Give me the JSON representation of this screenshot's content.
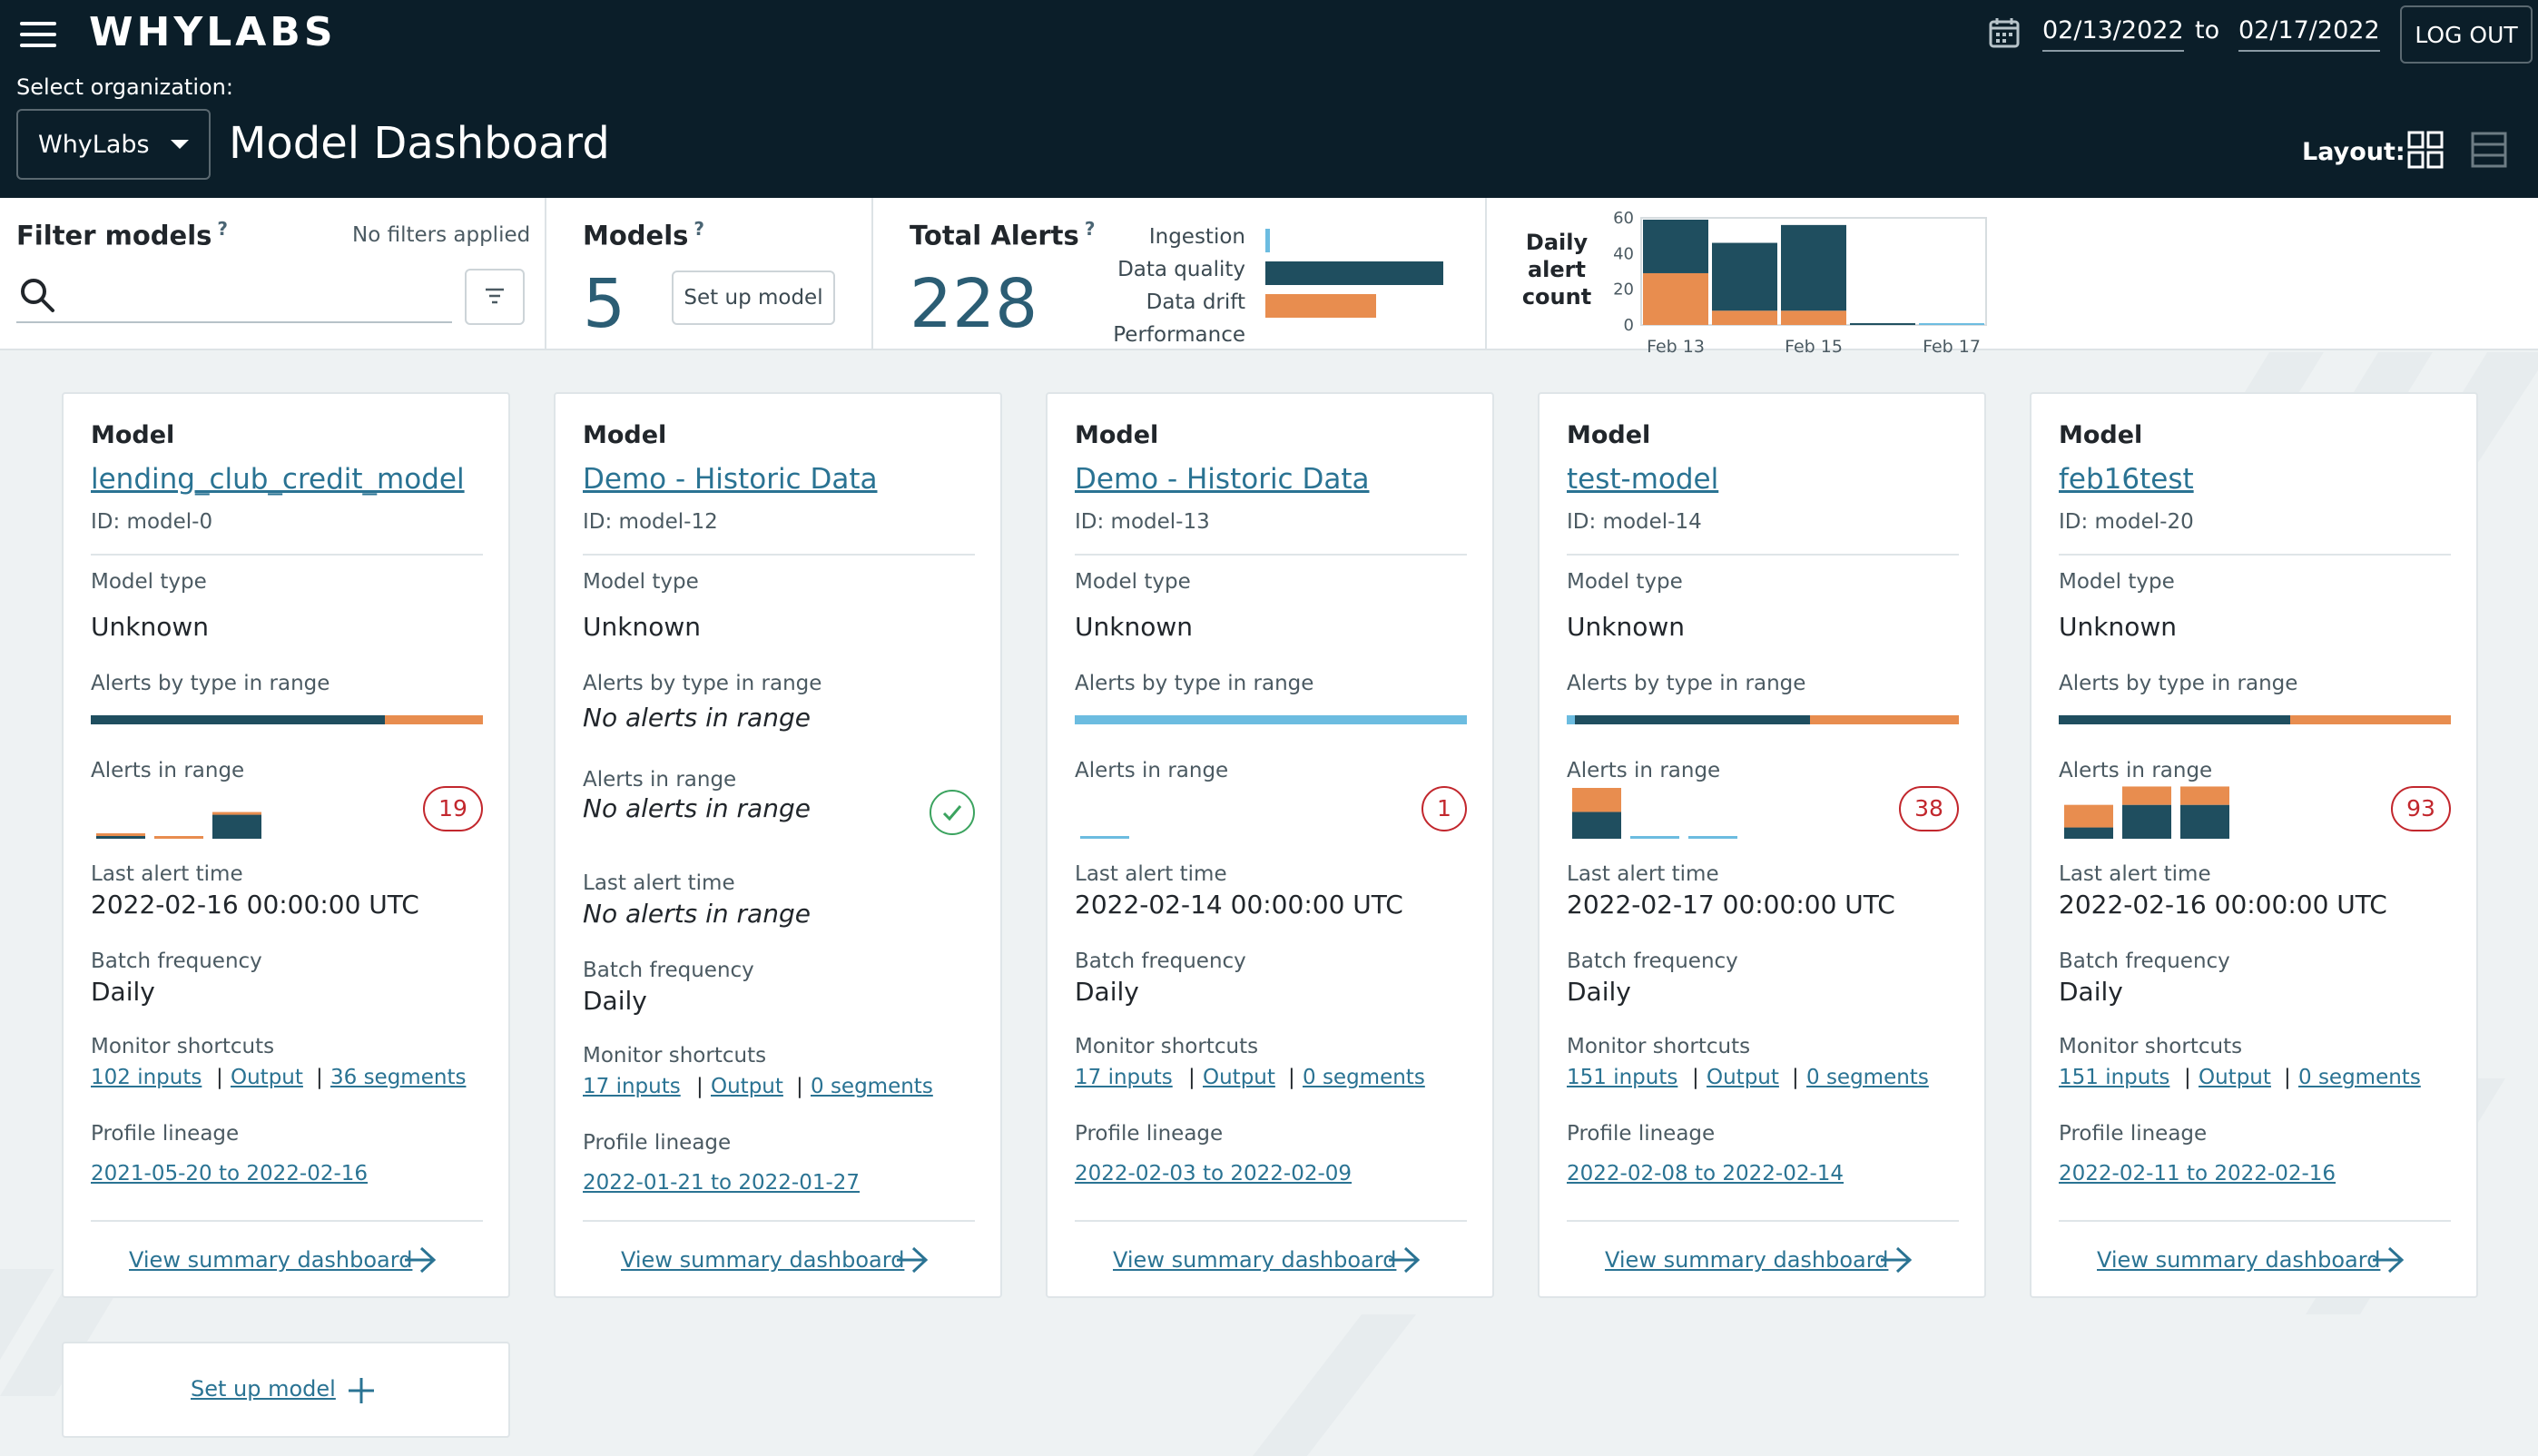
{
  "app": {
    "logo": "WHYLABS",
    "page_title": "Model Dashboard"
  },
  "header": {
    "org_label": "Select organization:",
    "org_selected": "WhyLabs",
    "date_from": "02/13/2022",
    "date_to_label": "to",
    "date_to": "02/17/2022",
    "logout": "LOG OUT",
    "layout_label": "Layout:"
  },
  "filter": {
    "title": "Filter models",
    "help": "?",
    "status": "No filters applied",
    "search_placeholder": "",
    "search_value": ""
  },
  "models_summary": {
    "title": "Models",
    "help": "?",
    "count": "5",
    "setup_button": "Set up model"
  },
  "alerts_summary": {
    "title": "Total Alerts",
    "help": "?",
    "count": "228",
    "types": [
      {
        "label": "Ingestion",
        "value": 1,
        "color": "#6cbce0"
      },
      {
        "label": "Data quality",
        "value": 98,
        "color": "#1f4e5f"
      },
      {
        "label": "Data drift",
        "value": 61,
        "color": "#e88d4f"
      },
      {
        "label": "Performance",
        "value": 0,
        "color": "#1f4e5f"
      }
    ],
    "max": 100
  },
  "daily_chart": {
    "label": "Daily alert count",
    "chart_data": {
      "type": "bar",
      "categories": [
        "Feb 13",
        "Feb 14",
        "Feb 15",
        "Feb 16",
        "Feb 17"
      ],
      "x_tick_labels": [
        "Feb 13",
        "Feb 15",
        "Feb 17"
      ],
      "series": [
        {
          "values": [
            29,
            8,
            8,
            0,
            0
          ],
          "color": "#e88d4f"
        },
        {
          "values": [
            30,
            38,
            48,
            1,
            0
          ],
          "color": "#1f4e5f"
        },
        {
          "values": [
            0,
            0,
            0,
            0,
            1
          ],
          "color": "#6cbce0"
        }
      ],
      "y_ticks": [
        0,
        20,
        40,
        60
      ],
      "ylim": [
        0,
        60
      ]
    }
  },
  "labels": {
    "model": "Model",
    "model_type": "Model type",
    "alerts_by_type": "Alerts by type in range",
    "alerts_in_range": "Alerts in range",
    "last_alert_time": "Last alert time",
    "batch_frequency": "Batch frequency",
    "monitor_shortcuts": "Monitor shortcuts",
    "profile_lineage": "Profile lineage",
    "view_summary": "View summary dashboard",
    "output": "Output",
    "sep": "|",
    "no_alerts": "No alerts in range"
  },
  "models": [
    {
      "name": "lending_club_credit_model",
      "id": "ID: model-0",
      "type": "Unknown",
      "alerts_by_type": [
        {
          "value": 75,
          "color": "#1f4e5f"
        },
        {
          "value": 25,
          "color": "#e88d4f"
        }
      ],
      "alert_count": "19",
      "daily": [
        {
          "q": 1,
          "d": 1,
          "i": 0
        },
        {
          "q": 0,
          "d": 1,
          "i": 0
        },
        {
          "q": 17,
          "d": 1,
          "i": 0
        }
      ],
      "last_alert": "2022-02-16 00:00:00 UTC",
      "batch": "Daily",
      "inputs": "102 inputs",
      "segments": "36 segments",
      "lineage": "2021-05-20 to 2022-02-16"
    },
    {
      "name": "Demo - Historic Data",
      "id": "ID: model-12",
      "type": "Unknown",
      "alerts_by_type": [],
      "alert_count": "",
      "daily": [],
      "last_alert": "No alerts in range",
      "batch": "Daily",
      "inputs": "17 inputs",
      "segments": "0 segments",
      "lineage": "2022-01-21 to 2022-01-27"
    },
    {
      "name": "Demo - Historic Data",
      "id": "ID: model-13",
      "type": "Unknown",
      "alerts_by_type": [
        {
          "value": 100,
          "color": "#6cbce0"
        }
      ],
      "alert_count": "1",
      "daily": [
        {
          "q": 0,
          "d": 0,
          "i": 1
        }
      ],
      "last_alert": "2022-02-14 00:00:00 UTC",
      "batch": "Daily",
      "inputs": "17 inputs",
      "segments": "0 segments",
      "lineage": "2022-02-03 to 2022-02-09"
    },
    {
      "name": "test-model",
      "id": "ID: model-14",
      "type": "Unknown",
      "alerts_by_type": [
        {
          "value": 2,
          "color": "#6cbce0"
        },
        {
          "value": 60,
          "color": "#1f4e5f"
        },
        {
          "value": 38,
          "color": "#e88d4f"
        }
      ],
      "alert_count": "38",
      "daily": [
        {
          "q": 19,
          "d": 17,
          "i": 0
        },
        {
          "q": 0,
          "d": 0,
          "i": 1
        },
        {
          "q": 0,
          "d": 0,
          "i": 1
        }
      ],
      "last_alert": "2022-02-17 00:00:00 UTC",
      "batch": "Daily",
      "inputs": "151 inputs",
      "segments": "0 segments",
      "lineage": "2022-02-08 to 2022-02-14"
    },
    {
      "name": "feb16test",
      "id": "ID: model-20",
      "type": "Unknown",
      "alerts_by_type": [
        {
          "value": 59,
          "color": "#1f4e5f"
        },
        {
          "value": 41,
          "color": "#e88d4f"
        }
      ],
      "alert_count": "93",
      "daily": [
        {
          "q": 8,
          "d": 16,
          "i": 0
        },
        {
          "q": 24,
          "d": 13,
          "i": 0
        },
        {
          "q": 24,
          "d": 13,
          "i": 0
        }
      ],
      "last_alert": "2022-02-16 00:00:00 UTC",
      "batch": "Daily",
      "inputs": "151 inputs",
      "segments": "0 segments",
      "lineage": "2022-02-11 to 2022-02-16"
    }
  ],
  "setup_card": {
    "label": "Set up model"
  }
}
